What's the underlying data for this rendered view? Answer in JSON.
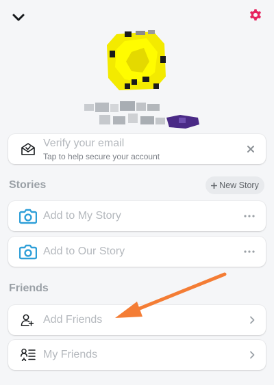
{
  "header": {
    "collapse_icon": "chevron-down-icon",
    "settings_icon": "gear-icon",
    "settings_color": "#e6225e"
  },
  "verify": {
    "title": "Verify your email",
    "subtitle": "Tap to help secure your account",
    "icon": "envelope-check-icon",
    "dismiss_icon": "close-icon"
  },
  "stories": {
    "section_title": "Stories",
    "new_story_label": "New Story",
    "new_story_icon": "plus-icon",
    "items": [
      {
        "label": "Add to My Story",
        "icon": "camera-icon",
        "more_icon": "more-dots-icon"
      },
      {
        "label": "Add to Our Story",
        "icon": "camera-icon",
        "more_icon": "more-dots-icon"
      }
    ]
  },
  "friends": {
    "section_title": "Friends",
    "items": [
      {
        "label": "Add Friends",
        "icon": "add-person-icon",
        "chevron_icon": "chevron-right-icon"
      },
      {
        "label": "My Friends",
        "icon": "friends-list-icon",
        "chevron_icon": "chevron-right-icon"
      }
    ]
  },
  "colors": {
    "accent_camera": "#2e9fd8",
    "annotation_arrow": "#f47d35",
    "snapcode_yellow": "#fffc00"
  }
}
